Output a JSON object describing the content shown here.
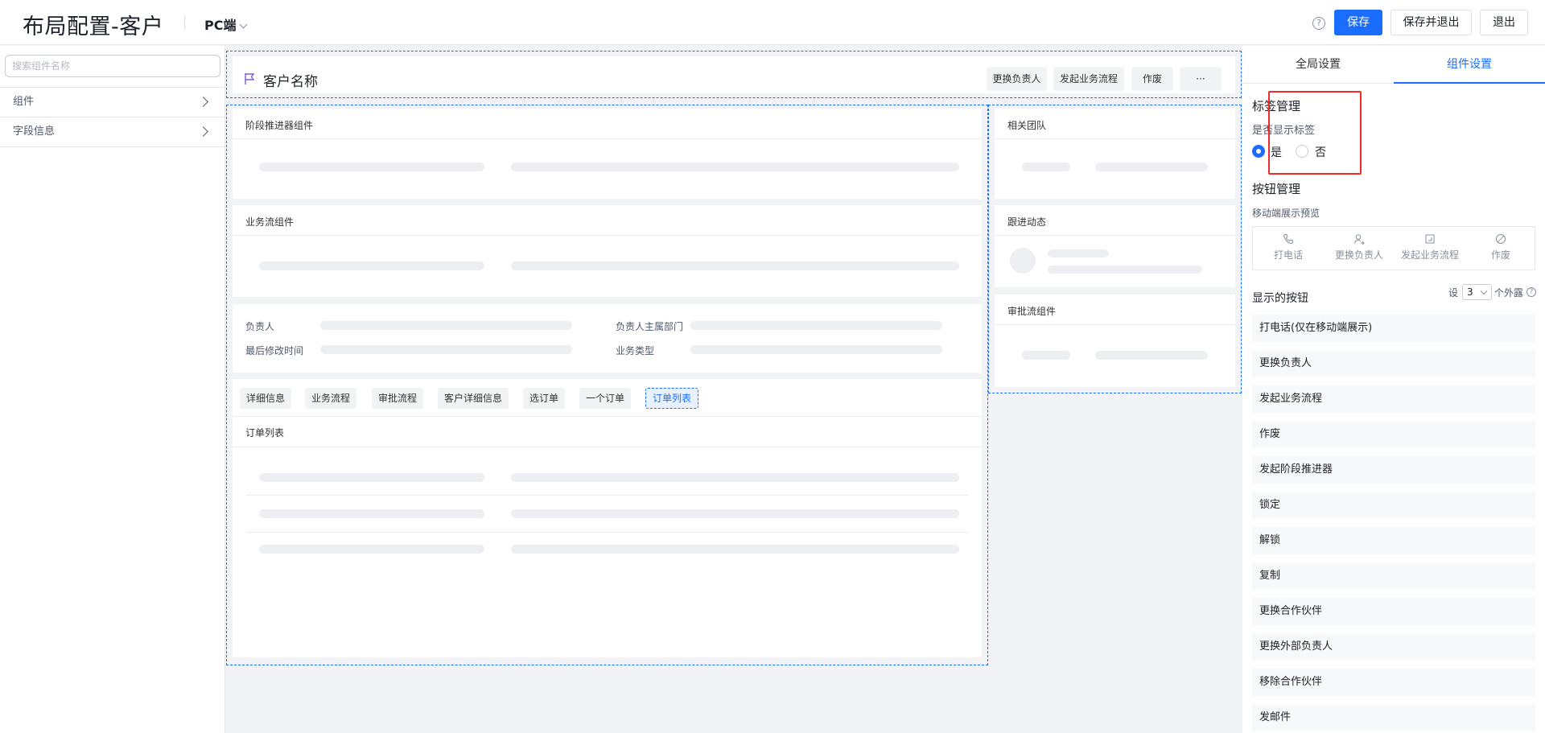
{
  "header": {
    "title": "布局配置-客户",
    "platform": "PC端",
    "help": "?",
    "save": "保存",
    "save_exit": "保存并退出",
    "exit": "退出"
  },
  "left": {
    "search_placeholder": "搜索组件名称",
    "items": [
      "组件",
      "字段信息"
    ]
  },
  "canvas": {
    "customer_name": "客户名称",
    "name_buttons": [
      "更换负责人",
      "发起业务流程",
      "作废",
      "···"
    ],
    "stage_component": "阶段推进器组件",
    "flow_component": "业务流组件",
    "fields": [
      "负责人",
      "负责人主属部门",
      "最后修改时间",
      "业务类型"
    ],
    "tabs": [
      "详细信息",
      "业务流程",
      "审批流程",
      "客户详细信息",
      "选订单",
      "一个订单",
      "订单列表"
    ],
    "active_tab": 6,
    "order_list_title": "订单列表",
    "related_team": "相关团队",
    "follow_up": "跟进动态",
    "approval_component": "审批流组件"
  },
  "right": {
    "tabs": [
      "全局设置",
      "组件设置"
    ],
    "active_tab": 1,
    "tag_section": "标签管理",
    "tag_question": "是否显示标签",
    "tag_yes": "是",
    "tag_no": "否",
    "tag_selected": "是",
    "button_section": "按钮管理",
    "mobile_preview": "移动端展示预览",
    "preview_items": [
      {
        "label": "打电话",
        "icon": "phone-icon"
      },
      {
        "label": "更换负责人",
        "icon": "user-swap-icon"
      },
      {
        "label": "发起业务流程",
        "icon": "flow-icon"
      },
      {
        "label": "作废",
        "icon": "ban-icon"
      }
    ],
    "shown_buttons": "显示的按钮",
    "set_prefix": "设",
    "exposed_count": "3",
    "set_suffix": "个外露",
    "button_list": [
      "打电话(仅在移动端展示)",
      "更换负责人",
      "发起业务流程",
      "作废",
      "发起阶段推进器",
      "锁定",
      "解锁",
      "复制",
      "更换合作伙伴",
      "更换外部负责人",
      "移除合作伙伴",
      "发邮件"
    ]
  },
  "colors": {
    "accent": "#1a6dff",
    "highlight": "#f02a2a"
  }
}
